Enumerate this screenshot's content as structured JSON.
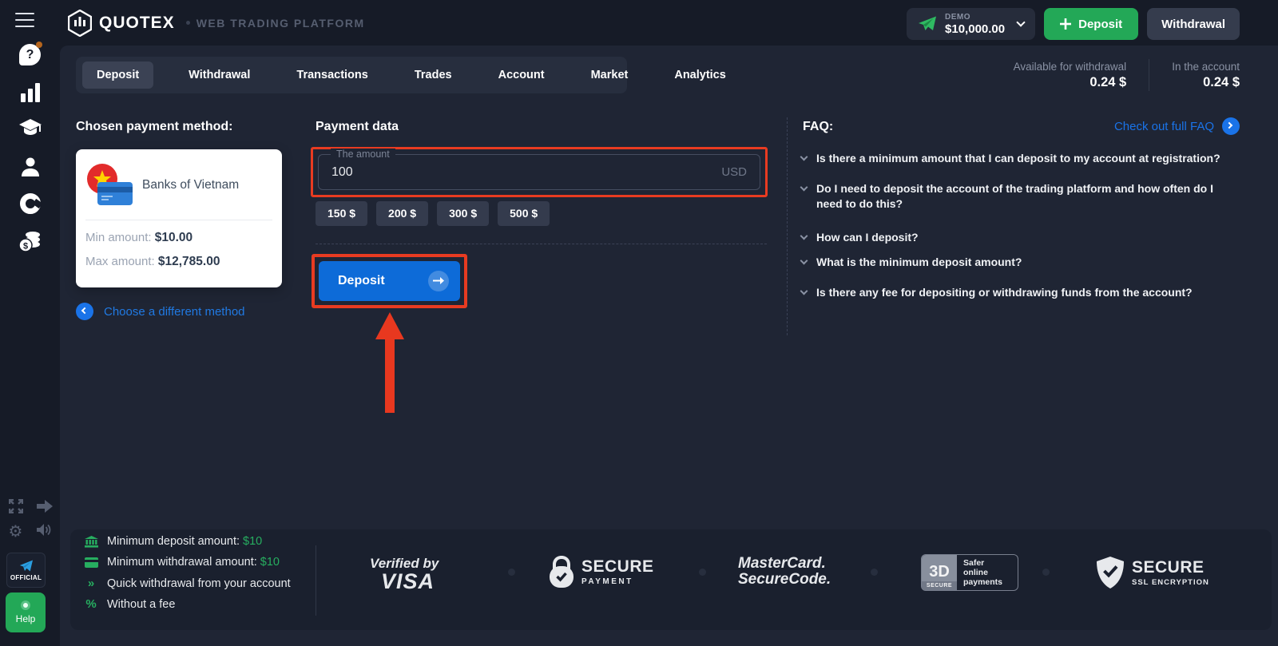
{
  "header": {
    "logo": "QUOTEX",
    "tagline": "WEB TRADING PLATFORM",
    "account_switcher": {
      "type": "DEMO",
      "balance": "$10,000.00"
    },
    "deposit_button": "Deposit",
    "withdrawal_button": "Withdrawal"
  },
  "tabs": [
    "Deposit",
    "Withdrawal",
    "Transactions",
    "Trades",
    "Account",
    "Market",
    "Analytics"
  ],
  "balances": {
    "available_label": "Available for withdrawal",
    "available_value": "0.24 $",
    "in_account_label": "In the account",
    "in_account_value": "0.24 $"
  },
  "payment_method": {
    "heading": "Chosen payment method:",
    "name": "Banks of Vietnam",
    "min_label": "Min amount: ",
    "min_value": "$10.00",
    "max_label": "Max amount: ",
    "max_value": "$12,785.00",
    "change_link": "Choose a different method"
  },
  "payment_data": {
    "heading": "Payment data",
    "amount_label": "The amount",
    "amount_value": "100",
    "currency": "USD",
    "quick_amounts": [
      "150 $",
      "200 $",
      "300 $",
      "500 $"
    ],
    "submit_label": "Deposit"
  },
  "faq": {
    "heading": "FAQ:",
    "full_faq_link": "Check out full FAQ",
    "questions": [
      "Is there a minimum amount that I can deposit to my account at registration?",
      "Do I need to deposit the account of the trading platform and how often do I need to do this?",
      "How can I deposit?",
      "What is the minimum deposit amount?",
      "Is there any fee for depositing or withdrawing funds from the account?"
    ]
  },
  "features": [
    {
      "icon": "bank-icon",
      "text": "Minimum deposit amount: ",
      "value": "$10"
    },
    {
      "icon": "card-icon",
      "text": "Minimum withdrawal amount: ",
      "value": "$10"
    },
    {
      "icon": "double-chevron-icon",
      "glyph": "»",
      "text": "Quick withdrawal from your account",
      "value": ""
    },
    {
      "icon": "percent-icon",
      "glyph": "%",
      "text": "Without a fee",
      "value": ""
    }
  ],
  "badges": {
    "visa": {
      "line1": "Verified by",
      "line2": "VISA"
    },
    "secure_payment": {
      "line1": "SECURE",
      "line2": "PAYMENT"
    },
    "mastercard": {
      "line1": "MasterCard.",
      "line2": "SecureCode."
    },
    "three_d": {
      "big": "3D",
      "small": "SECURE",
      "side": "Safer online payments"
    },
    "ssl": {
      "line1": "SECURE",
      "line2": "SSL ENCRYPTION"
    }
  },
  "sidebar": {
    "official_label": "OFFICIAL",
    "help_label": "Help"
  },
  "colors": {
    "accent_blue": "#0d6bd8",
    "link_blue": "#2079e2",
    "green": "#23a857",
    "highlight_red": "#e83b21"
  }
}
